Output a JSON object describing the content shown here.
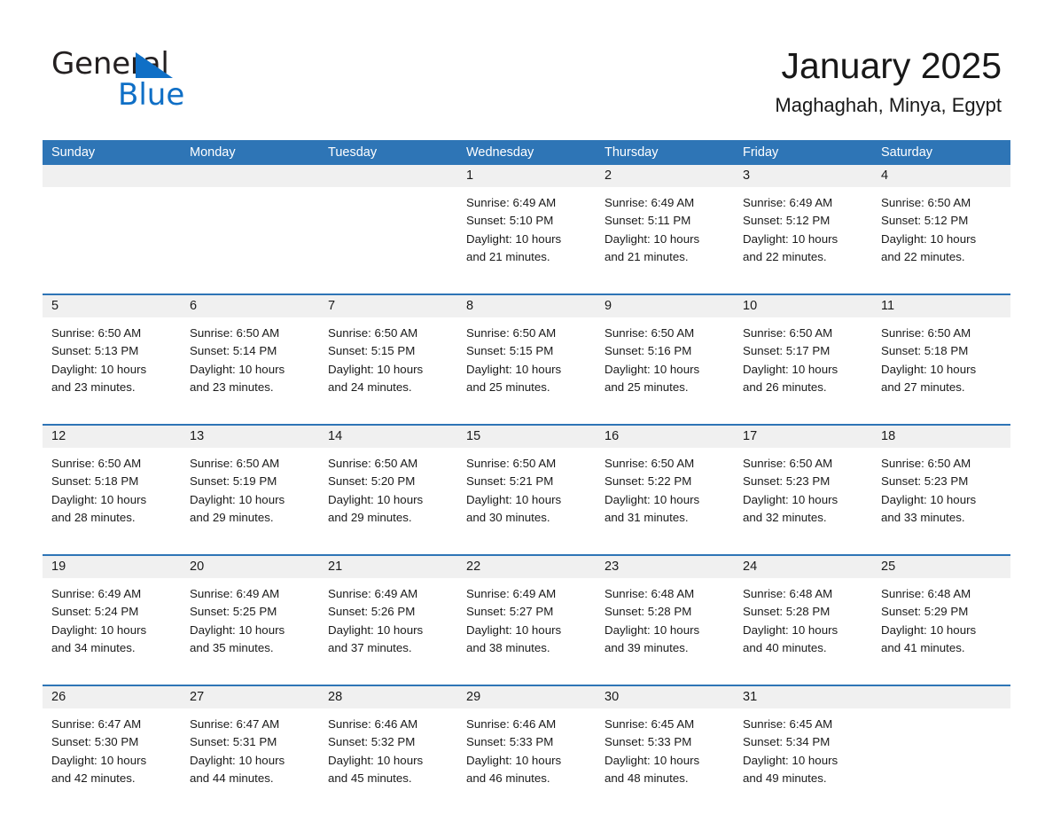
{
  "logo": {
    "word_one": "General",
    "word_two": "Blue",
    "triangle_icon": "triangle-icon",
    "accent_color": "#0f6fc6"
  },
  "header": {
    "title": "January 2025",
    "subtitle": "Maghaghah, Minya, Egypt"
  },
  "colors": {
    "header_blue": "#2e75b6",
    "date_band": "#f0f0f0",
    "text": "#1a1a1a"
  },
  "calendar": {
    "weekdays": [
      "Sunday",
      "Monday",
      "Tuesday",
      "Wednesday",
      "Thursday",
      "Friday",
      "Saturday"
    ],
    "weeks": [
      [
        {
          "date": "",
          "lines": []
        },
        {
          "date": "",
          "lines": []
        },
        {
          "date": "",
          "lines": []
        },
        {
          "date": "1",
          "lines": [
            "Sunrise: 6:49 AM",
            "Sunset: 5:10 PM",
            "Daylight: 10 hours",
            "and 21 minutes."
          ]
        },
        {
          "date": "2",
          "lines": [
            "Sunrise: 6:49 AM",
            "Sunset: 5:11 PM",
            "Daylight: 10 hours",
            "and 21 minutes."
          ]
        },
        {
          "date": "3",
          "lines": [
            "Sunrise: 6:49 AM",
            "Sunset: 5:12 PM",
            "Daylight: 10 hours",
            "and 22 minutes."
          ]
        },
        {
          "date": "4",
          "lines": [
            "Sunrise: 6:50 AM",
            "Sunset: 5:12 PM",
            "Daylight: 10 hours",
            "and 22 minutes."
          ]
        }
      ],
      [
        {
          "date": "5",
          "lines": [
            "Sunrise: 6:50 AM",
            "Sunset: 5:13 PM",
            "Daylight: 10 hours",
            "and 23 minutes."
          ]
        },
        {
          "date": "6",
          "lines": [
            "Sunrise: 6:50 AM",
            "Sunset: 5:14 PM",
            "Daylight: 10 hours",
            "and 23 minutes."
          ]
        },
        {
          "date": "7",
          "lines": [
            "Sunrise: 6:50 AM",
            "Sunset: 5:15 PM",
            "Daylight: 10 hours",
            "and 24 minutes."
          ]
        },
        {
          "date": "8",
          "lines": [
            "Sunrise: 6:50 AM",
            "Sunset: 5:15 PM",
            "Daylight: 10 hours",
            "and 25 minutes."
          ]
        },
        {
          "date": "9",
          "lines": [
            "Sunrise: 6:50 AM",
            "Sunset: 5:16 PM",
            "Daylight: 10 hours",
            "and 25 minutes."
          ]
        },
        {
          "date": "10",
          "lines": [
            "Sunrise: 6:50 AM",
            "Sunset: 5:17 PM",
            "Daylight: 10 hours",
            "and 26 minutes."
          ]
        },
        {
          "date": "11",
          "lines": [
            "Sunrise: 6:50 AM",
            "Sunset: 5:18 PM",
            "Daylight: 10 hours",
            "and 27 minutes."
          ]
        }
      ],
      [
        {
          "date": "12",
          "lines": [
            "Sunrise: 6:50 AM",
            "Sunset: 5:18 PM",
            "Daylight: 10 hours",
            "and 28 minutes."
          ]
        },
        {
          "date": "13",
          "lines": [
            "Sunrise: 6:50 AM",
            "Sunset: 5:19 PM",
            "Daylight: 10 hours",
            "and 29 minutes."
          ]
        },
        {
          "date": "14",
          "lines": [
            "Sunrise: 6:50 AM",
            "Sunset: 5:20 PM",
            "Daylight: 10 hours",
            "and 29 minutes."
          ]
        },
        {
          "date": "15",
          "lines": [
            "Sunrise: 6:50 AM",
            "Sunset: 5:21 PM",
            "Daylight: 10 hours",
            "and 30 minutes."
          ]
        },
        {
          "date": "16",
          "lines": [
            "Sunrise: 6:50 AM",
            "Sunset: 5:22 PM",
            "Daylight: 10 hours",
            "and 31 minutes."
          ]
        },
        {
          "date": "17",
          "lines": [
            "Sunrise: 6:50 AM",
            "Sunset: 5:23 PM",
            "Daylight: 10 hours",
            "and 32 minutes."
          ]
        },
        {
          "date": "18",
          "lines": [
            "Sunrise: 6:50 AM",
            "Sunset: 5:23 PM",
            "Daylight: 10 hours",
            "and 33 minutes."
          ]
        }
      ],
      [
        {
          "date": "19",
          "lines": [
            "Sunrise: 6:49 AM",
            "Sunset: 5:24 PM",
            "Daylight: 10 hours",
            "and 34 minutes."
          ]
        },
        {
          "date": "20",
          "lines": [
            "Sunrise: 6:49 AM",
            "Sunset: 5:25 PM",
            "Daylight: 10 hours",
            "and 35 minutes."
          ]
        },
        {
          "date": "21",
          "lines": [
            "Sunrise: 6:49 AM",
            "Sunset: 5:26 PM",
            "Daylight: 10 hours",
            "and 37 minutes."
          ]
        },
        {
          "date": "22",
          "lines": [
            "Sunrise: 6:49 AM",
            "Sunset: 5:27 PM",
            "Daylight: 10 hours",
            "and 38 minutes."
          ]
        },
        {
          "date": "23",
          "lines": [
            "Sunrise: 6:48 AM",
            "Sunset: 5:28 PM",
            "Daylight: 10 hours",
            "and 39 minutes."
          ]
        },
        {
          "date": "24",
          "lines": [
            "Sunrise: 6:48 AM",
            "Sunset: 5:28 PM",
            "Daylight: 10 hours",
            "and 40 minutes."
          ]
        },
        {
          "date": "25",
          "lines": [
            "Sunrise: 6:48 AM",
            "Sunset: 5:29 PM",
            "Daylight: 10 hours",
            "and 41 minutes."
          ]
        }
      ],
      [
        {
          "date": "26",
          "lines": [
            "Sunrise: 6:47 AM",
            "Sunset: 5:30 PM",
            "Daylight: 10 hours",
            "and 42 minutes."
          ]
        },
        {
          "date": "27",
          "lines": [
            "Sunrise: 6:47 AM",
            "Sunset: 5:31 PM",
            "Daylight: 10 hours",
            "and 44 minutes."
          ]
        },
        {
          "date": "28",
          "lines": [
            "Sunrise: 6:46 AM",
            "Sunset: 5:32 PM",
            "Daylight: 10 hours",
            "and 45 minutes."
          ]
        },
        {
          "date": "29",
          "lines": [
            "Sunrise: 6:46 AM",
            "Sunset: 5:33 PM",
            "Daylight: 10 hours",
            "and 46 minutes."
          ]
        },
        {
          "date": "30",
          "lines": [
            "Sunrise: 6:45 AM",
            "Sunset: 5:33 PM",
            "Daylight: 10 hours",
            "and 48 minutes."
          ]
        },
        {
          "date": "31",
          "lines": [
            "Sunrise: 6:45 AM",
            "Sunset: 5:34 PM",
            "Daylight: 10 hours",
            "and 49 minutes."
          ]
        },
        {
          "date": "",
          "lines": []
        }
      ]
    ]
  }
}
